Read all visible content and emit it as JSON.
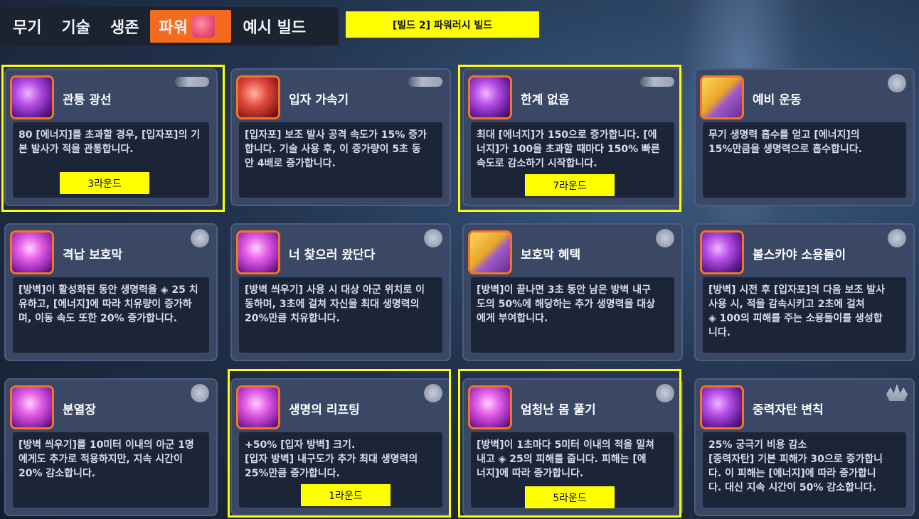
{
  "tabs": [
    "무기",
    "기술",
    "생존",
    "파워",
    "예시 빌드"
  ],
  "active_tab": "파워",
  "build_label": "[빌드 2] 파워러시 빌드",
  "colors": {
    "accent": "#f46a1e",
    "highlight": "#ffff00",
    "card": "#3a4866"
  },
  "cards": [
    {
      "title": "관통 광선",
      "lines": [
        "80 [에너지]를 초과할 경우, [입자포]의 기",
        "본 발사가 적을 관통합니다."
      ],
      "round": "3라운드"
    },
    {
      "title": "입자 가속기",
      "lines": [
        "[입자포] 보조 발사 공격 속도가 15% 증가",
        "합니다. 기술 사용 후, 이 증가량이 5초 동",
        "안 4배로 증가합니다."
      ]
    },
    {
      "title": "한계 없음",
      "lines": [
        "최대 [에너지]가 150으로 증가합니다. [에",
        "너지]가 100을 초과할 때마다 150% 빠른",
        "속도로 감소하기 시작합니다."
      ],
      "round": "7라운드"
    },
    {
      "title": "예비 운동",
      "lines": [
        "무기 생명력 흡수를 얻고 [에너지]의",
        "15%만큼을 생명력으로 흡수합니다."
      ]
    },
    {
      "title": "격납 보호막",
      "lines": [
        "[방벽]이 활성화된 동안 생명력을 ◈ 25 치",
        "유하고, [에너지]에 따라 치유량이 증가하",
        "며, 이동 속도 또한 20% 증가합니다."
      ]
    },
    {
      "title": "너 찾으러 왔단다",
      "lines": [
        "[방벽 씌우기] 사용 시 대상 아군 위치로 이",
        "동하며, 3초에 걸쳐 자신을 최대 생명력의",
        "20%만큼 치유합니다."
      ]
    },
    {
      "title": "보호막 혜택",
      "lines": [
        "[방벽]이 끝나면 3초 동안 남은 방벽 내구",
        "도의 50%에 해당하는 추가 생명력을 대상",
        "에게 부여합니다."
      ]
    },
    {
      "title": "볼스카야 소용돌이",
      "lines": [
        "[방벽] 시전 후 [입자포]의 다음 보조 발사",
        "사용 시, 적을 감속시키고 2초에 걸쳐",
        "◈ 100의 피해를 주는 소용돌이를 생성합",
        "니다."
      ]
    },
    {
      "title": "분열장",
      "lines": [
        "[방벽 씌우기]를 10미터 이내의 아군 1명",
        "에게도 추가로 적용하지만, 지속 시간이",
        "20% 감소합니다."
      ]
    },
    {
      "title": "생명의 리프팅",
      "lines": [
        "+50% [입자 방벽] 크기.",
        "[입자 방벽] 내구도가 추가 최대 생명력의",
        "25%만큼 증가합니다."
      ],
      "round": "1라운드"
    },
    {
      "title": "엄청난 몸 풀기",
      "lines": [
        "[방벽]이 1초마다 5미터 이내의 적을 밀쳐",
        "내고 ◈ 25의 피해를 줍니다. 피해는 [에",
        "너지]에 따라 증가합니다."
      ],
      "round": "5라운드"
    },
    {
      "title": "중력자탄 변칙",
      "lines": [
        "25% 궁극기 비용 감소",
        "[중력자탄] 기본 피해가 30으로 증가합니",
        "다. 이 피해는 [에너지]에 따라 증가합니",
        "다. 대신 지속 시간이 50% 감소합니다."
      ]
    }
  ]
}
